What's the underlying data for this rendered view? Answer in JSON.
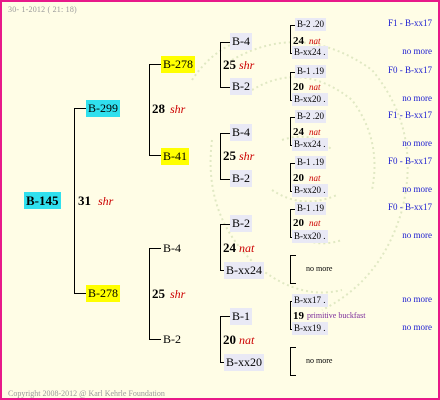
{
  "header": {
    "text": "30-  1-2012 ( 21: 18)"
  },
  "footer": {
    "text": "Copyright 2008-2012 @ Karl Kehrle Foundation"
  },
  "root": {
    "name": "B-145",
    "number": "31",
    "sex": "shr"
  },
  "gen1": [
    {
      "name": "B-299",
      "number": "28",
      "sex": "shr"
    },
    {
      "name": "B-278",
      "number": "25",
      "sex": "shr"
    }
  ],
  "gen2": [
    {
      "name": "B-278",
      "number": "25",
      "sex": "shr"
    },
    {
      "name": "B-41",
      "number": "25",
      "sex": "shr"
    },
    {
      "name": "B-4",
      "number": "24",
      "sex": "nat"
    },
    {
      "name": "B-2",
      "number": "20",
      "sex": "nat"
    }
  ],
  "gen3": [
    {
      "name": "B-4",
      "number": "24",
      "sex": "nat"
    },
    {
      "name": "B-2",
      "number": "20",
      "sex": "nat"
    },
    {
      "name": "B-4",
      "number": "24",
      "sex": "nat"
    },
    {
      "name": "B-2",
      "number": "20",
      "sex": "nat"
    },
    {
      "name": "B-2",
      "number": "20",
      "sex": "nat"
    },
    {
      "name": "B-xx24",
      "number": "",
      "sex": ""
    },
    {
      "name": "B-1",
      "number": "19",
      "sex": "primitive buckfast"
    },
    {
      "name": "B-xx20",
      "number": "",
      "sex": ""
    }
  ],
  "gen4": [
    {
      "name": "B-2 .20",
      "right": "F1 - B-xx17"
    },
    {
      "name": "B-xx24 .",
      "right": "no more"
    },
    {
      "name": "B-1 .19",
      "right": "F0 - B-xx17"
    },
    {
      "name": "B-xx20 .",
      "right": "no more"
    },
    {
      "name": "B-2 .20",
      "right": "F1 - B-xx17"
    },
    {
      "name": "B-xx24 .",
      "right": "no more"
    },
    {
      "name": "B-1 .19",
      "right": "F0 - B-xx17"
    },
    {
      "name": "B-xx20 .",
      "right": "no more"
    },
    {
      "name": "B-1 .19",
      "right": "F0 - B-xx17"
    },
    {
      "name": "B-xx20 .",
      "right": "no more"
    },
    {
      "name": "B-xx17 .",
      "right": "no more"
    },
    {
      "name": "B-xx19 .",
      "right": "no more"
    }
  ],
  "nomore": [
    "no more",
    "no more"
  ]
}
